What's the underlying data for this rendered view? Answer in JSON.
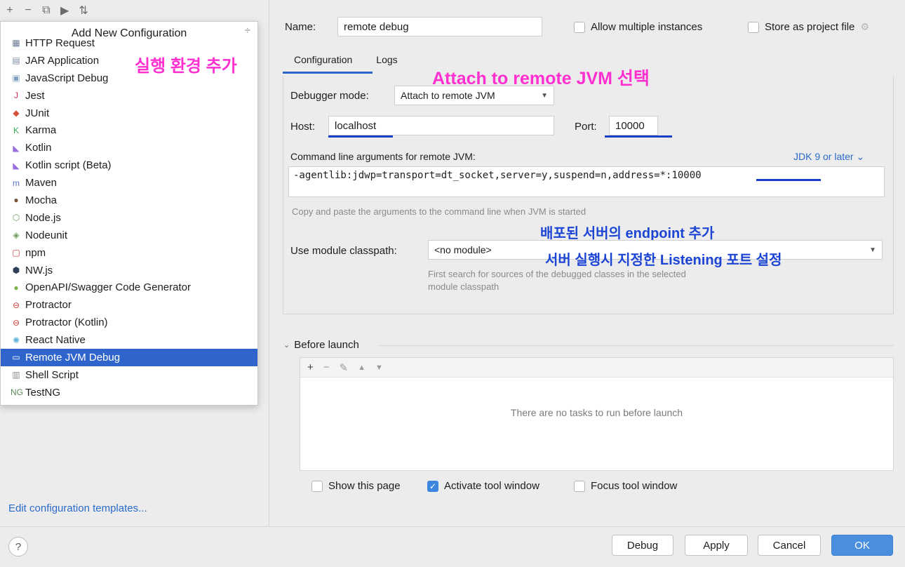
{
  "left": {
    "toolbar_icons": [
      "+",
      "−",
      "⧉",
      "▶",
      "⇅"
    ],
    "popup_title": "Add New Configuration",
    "popup_sort_icon": "÷",
    "items": [
      {
        "label": "HTTP Request",
        "icon": "▦",
        "color": "#6b7c93"
      },
      {
        "label": "JAR Application",
        "icon": "▤",
        "color": "#7d8da3"
      },
      {
        "label": "JavaScript Debug",
        "icon": "▣",
        "color": "#7ea0c7"
      },
      {
        "label": "Jest",
        "icon": "J",
        "color": "#c3344f"
      },
      {
        "label": "JUnit",
        "icon": "◆",
        "color": "#d5523b"
      },
      {
        "label": "Karma",
        "icon": "K",
        "color": "#3aa757"
      },
      {
        "label": "Kotlin",
        "icon": "◣",
        "color": "#9a6cde"
      },
      {
        "label": "Kotlin script (Beta)",
        "icon": "◣",
        "color": "#9a6cde"
      },
      {
        "label": "Maven",
        "icon": "m",
        "color": "#5a74c6"
      },
      {
        "label": "Mocha",
        "icon": "●",
        "color": "#7a5235"
      },
      {
        "label": "Node.js",
        "icon": "⬡",
        "color": "#6a9a5a"
      },
      {
        "label": "Nodeunit",
        "icon": "◈",
        "color": "#6a9a5a"
      },
      {
        "label": "npm",
        "icon": "▢",
        "color": "#cb3837"
      },
      {
        "label": "NW.js",
        "icon": "⬢",
        "color": "#2f3f55"
      },
      {
        "label": "OpenAPI/Swagger Code Generator",
        "icon": "●",
        "color": "#79b349"
      },
      {
        "label": "Protractor",
        "icon": "⊖",
        "color": "#d73b3b"
      },
      {
        "label": "Protractor (Kotlin)",
        "icon": "⊖",
        "color": "#d73b3b"
      },
      {
        "label": "React Native",
        "icon": "✺",
        "color": "#61b5d9"
      },
      {
        "label": "Remote JVM Debug",
        "icon": "▭",
        "color": "#ffffff"
      },
      {
        "label": "Shell Script",
        "icon": "▥",
        "color": "#8a8a8a"
      },
      {
        "label": "TestNG",
        "icon": "NG",
        "color": "#5a8a5a"
      }
    ],
    "selected_index": 18,
    "edit_templates": "Edit configuration templates..."
  },
  "annotations": {
    "add_env": "실행 환경 추가",
    "attach": "Attach to remote JVM 선택",
    "endpoint": "배포된 서버의 endpoint 추가",
    "port_setting": "서버 실행시 지정한 Listening 포트 설정"
  },
  "right": {
    "name_label": "Name:",
    "name_value": "remote debug",
    "allow_multiple": "Allow multiple instances",
    "store_project": "Store as project file",
    "gear_icon": "⚙",
    "tabs": [
      "Configuration",
      "Logs"
    ],
    "debugger_mode_label": "Debugger mode:",
    "debugger_mode_value": "Attach to remote JVM",
    "host_label": "Host:",
    "host_value": "localhost",
    "port_label": "Port:",
    "port_value": "10000",
    "cmd_label": "Command line arguments for remote JVM:",
    "jdk_link": "JDK 9 or later ⌄",
    "cmd_value": "-agentlib:jdwp=transport=dt_socket,server=y,suspend=n,address=*:10000",
    "cmd_hint": "Copy and paste the arguments to the command line when JVM is started",
    "module_label": "Use module classpath:",
    "module_value": "<no module>",
    "module_hint_1": "First search for sources of the debugged classes in the selected",
    "module_hint_2": "module classpath",
    "before_launch": "Before launch",
    "tasks_toolbar": [
      "+",
      "−",
      "✎",
      "▲",
      "▼"
    ],
    "no_tasks": "There are no tasks to run before launch",
    "show_page": "Show this page",
    "activate_tool": "Activate tool window",
    "focus_tool": "Focus tool window",
    "activate_checked": true
  },
  "footer": {
    "help": "?",
    "debug": "Debug",
    "apply": "Apply",
    "cancel": "Cancel",
    "ok": "OK"
  }
}
